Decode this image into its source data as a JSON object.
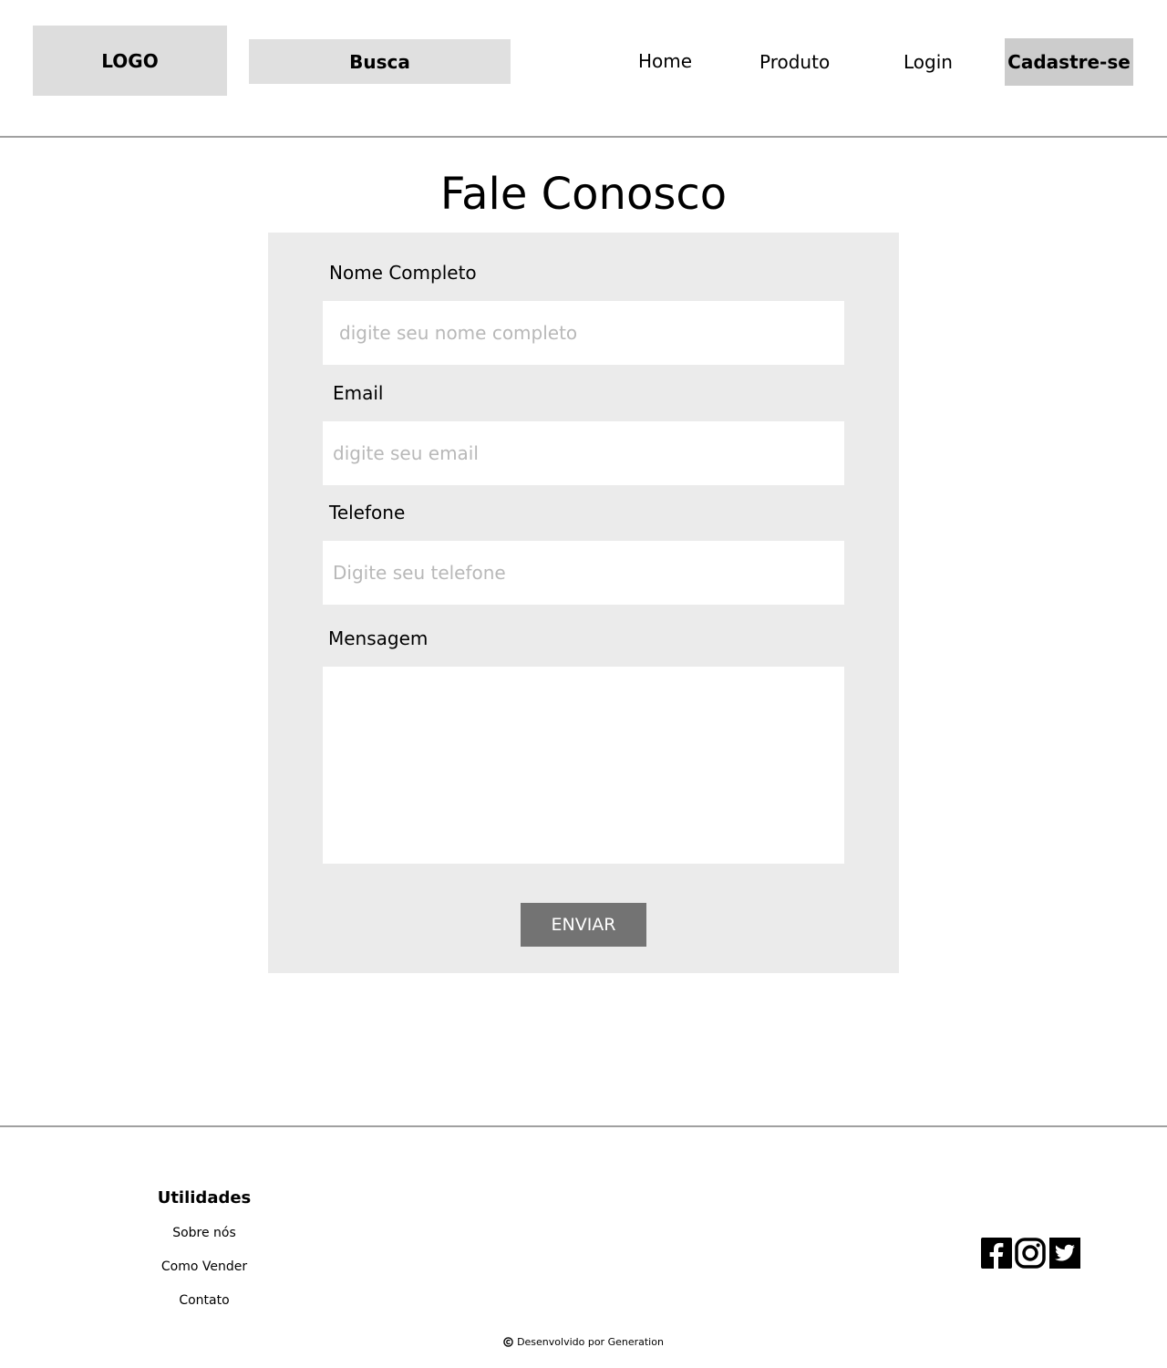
{
  "header": {
    "logo": "LOGO",
    "search_label": "Busca",
    "nav": [
      "Home",
      "Produto",
      "Login"
    ],
    "signup": "Cadastre-se"
  },
  "main": {
    "title": "Fale Conosco",
    "fields": [
      {
        "label": "Nome Completo",
        "placeholder": "digite seu nome completo",
        "value": ""
      },
      {
        "label": "Email",
        "placeholder": "digite seu email",
        "value": ""
      },
      {
        "label": "Telefone",
        "placeholder": "Digite seu telefone",
        "value": ""
      }
    ],
    "message_label": "Mensagem",
    "submit": "ENVIAR"
  },
  "footer": {
    "heading": "Utilidades",
    "links": [
      "Sobre nós",
      "Como Vender",
      "Contato"
    ],
    "social": [
      "facebook-icon",
      "instagram-icon",
      "twitter-icon"
    ],
    "copyright": "Desenvolvido por Generation"
  }
}
